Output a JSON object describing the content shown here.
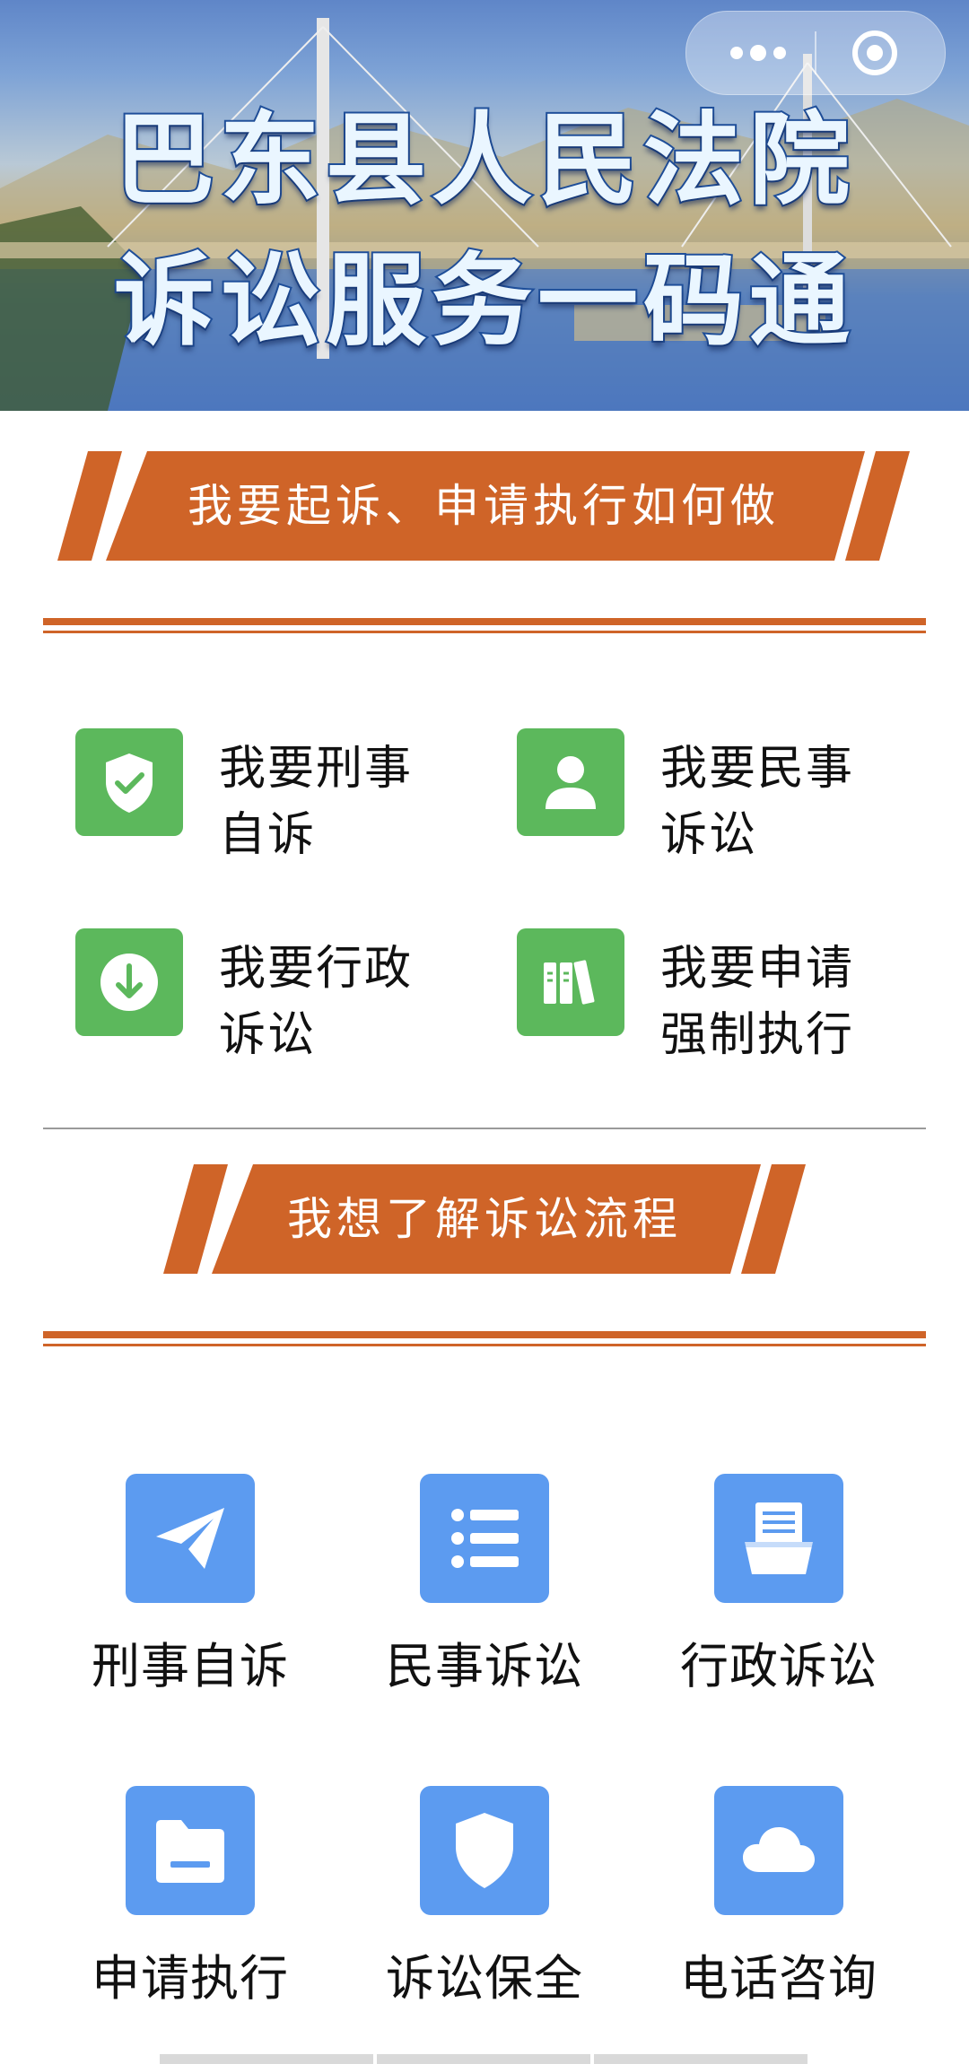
{
  "banner": {
    "title_line1": "巴东县人民法院",
    "title_line2": "诉讼服务一码通"
  },
  "capsule": {
    "menu_icon": "more-dots-icon",
    "close_icon": "target-circle-icon"
  },
  "section1": {
    "header": "我要起诉、申请执行如何做",
    "items": [
      {
        "line1": "我要刑事",
        "line2": "自诉",
        "icon": "shield-check-icon"
      },
      {
        "line1": "我要民事",
        "line2": "诉讼",
        "icon": "user-icon"
      },
      {
        "line1": "我要行政",
        "line2": "诉讼",
        "icon": "download-circle-icon"
      },
      {
        "line1": "我要申请",
        "line2": "强制执行",
        "icon": "books-icon"
      }
    ]
  },
  "section2": {
    "header": "我想了解诉讼流程",
    "items": [
      {
        "label": "刑事自诉",
        "icon": "paper-plane-icon"
      },
      {
        "label": "民事诉讼",
        "icon": "list-icon"
      },
      {
        "label": "行政诉讼",
        "icon": "document-tray-icon"
      },
      {
        "label": "申请执行",
        "icon": "folder-icon"
      },
      {
        "label": "诉讼保全",
        "icon": "shield-icon"
      },
      {
        "label": "电话咨询",
        "icon": "cloud-icon"
      }
    ]
  },
  "colors": {
    "accent_orange": "#cf6428",
    "action_green": "#5cb85c",
    "process_blue": "#5c9bf0"
  }
}
